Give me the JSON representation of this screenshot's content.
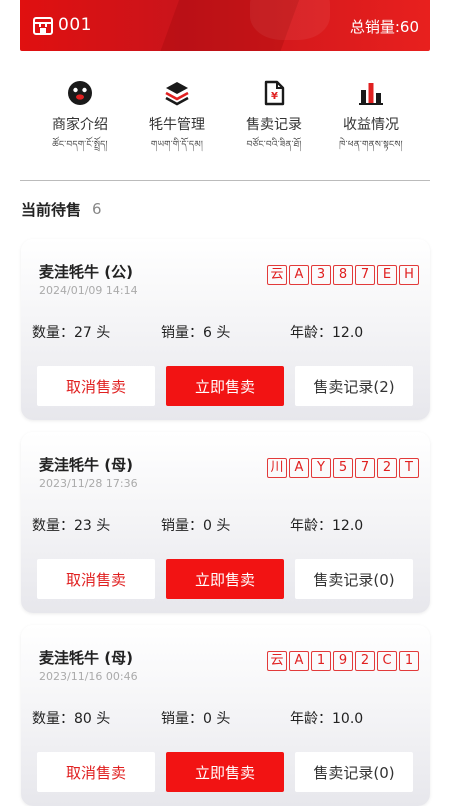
{
  "header": {
    "shop_id": "001",
    "total_sales": "总销量:60",
    "shop_icon": "store-icon",
    "color": "#e01010"
  },
  "menu": [
    {
      "icon": "face-icon",
      "label": "商家介绍",
      "sub": "ཚོང་བདག་ངོ་སྤྲོད།"
    },
    {
      "icon": "layers-icon",
      "label": "牦牛管理",
      "sub": "གཡག་གི་དོ་དམ།"
    },
    {
      "icon": "document-icon",
      "label": "售卖记录",
      "sub": "བཙོང་བའི་ཟིན་ཐོ།"
    },
    {
      "icon": "bar-chart-icon",
      "label": "收益情况",
      "sub": "ཁེ་ཕན་གནས་སྟངས།"
    }
  ],
  "section": {
    "title": "当前待售",
    "count": "6"
  },
  "cards": [
    {
      "name": "麦洼牦牛 (公)",
      "time": "2024/01/09 14:14",
      "plate": [
        "云",
        "A",
        "3",
        "8",
        "7",
        "E",
        "H"
      ],
      "quantity": "数量：27 头",
      "sales": "销量：6 头",
      "age": "年龄：12.0",
      "cancel_label": "取消售卖",
      "sell_label": "立即售卖",
      "record_label": "售卖记录(2)"
    },
    {
      "name": "麦洼牦牛 (母)",
      "time": "2023/11/28 17:36",
      "plate": [
        "川",
        "A",
        "Y",
        "5",
        "7",
        "2",
        "T"
      ],
      "quantity": "数量：23 头",
      "sales": "销量：0 头",
      "age": "年龄：12.0",
      "cancel_label": "取消售卖",
      "sell_label": "立即售卖",
      "record_label": "售卖记录(0)"
    },
    {
      "name": "麦洼牦牛 (母)",
      "time": "2023/11/16 00:46",
      "plate": [
        "云",
        "A",
        "1",
        "9",
        "2",
        "C",
        "1"
      ],
      "quantity": "数量：80 头",
      "sales": "销量：0 头",
      "age": "年龄：10.0",
      "cancel_label": "取消售卖",
      "sell_label": "立即售卖",
      "record_label": "售卖记录(0)"
    }
  ],
  "colors": {
    "accent": "#f21313",
    "muted": "#aaaaaa"
  }
}
